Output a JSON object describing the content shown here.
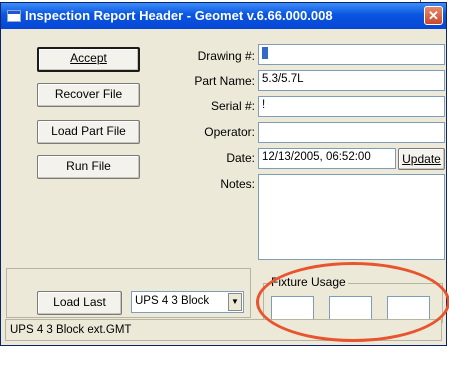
{
  "window": {
    "title": "Inspection Report Header - Geomet v.6.66.000.008",
    "close_glyph": "✕"
  },
  "buttons": {
    "accept": "Accept",
    "recover_file": "Recover File",
    "load_part_file": "Load Part File",
    "run_file": "Run File",
    "update": "Update",
    "load_last": "Load Last"
  },
  "form": {
    "drawing_label": "Drawing #:",
    "drawing_value": "",
    "part_name_label": "Part Name:",
    "part_name_value": "5.3/5.7L",
    "serial_label": "Serial #:",
    "serial_value": "!",
    "operator_label": "Operator:",
    "operator_value": "",
    "date_label": "Date:",
    "date_value": "12/13/2005, 06:52:00",
    "notes_label": "Notes:",
    "notes_value": ""
  },
  "last_select": {
    "selected": "UPS 4 3 Block"
  },
  "fixture": {
    "title": "Fixture Usage",
    "fields": [
      "",
      "",
      ""
    ]
  },
  "status": {
    "text": "UPS 4 3 Block ext.GMT"
  },
  "annotation": {
    "color": "#e8542d"
  }
}
